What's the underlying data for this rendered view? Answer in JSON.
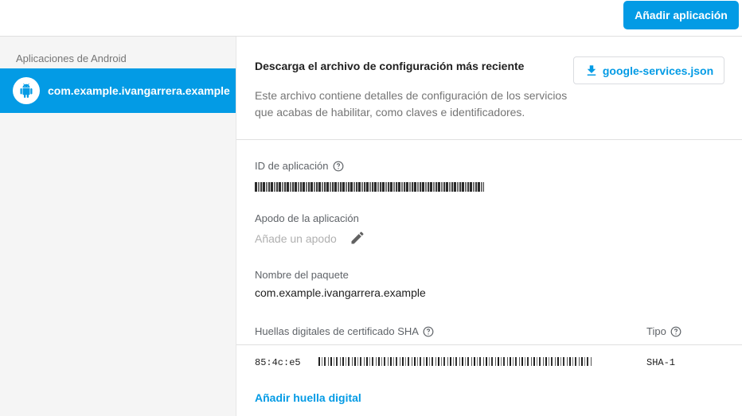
{
  "header": {
    "add_app_label": "Añadir aplicación"
  },
  "sidebar": {
    "heading": "Aplicaciones de Android",
    "items": [
      {
        "label": "com.example.ivangarrera.example",
        "icon": "android-icon"
      }
    ]
  },
  "config": {
    "title": "Descarga el archivo de configuración más reciente",
    "description": "Este archivo contiene detalles de configuración de los servicios que acabas de habilitar, como claves e identificadores.",
    "download_label": "google-services.json"
  },
  "details": {
    "app_id_label": "ID de aplicación",
    "nickname_label": "Apodo de la aplicación",
    "nickname_placeholder": "Añade un apodo",
    "package_label": "Nombre del paquete",
    "package_value": "com.example.ivangarrera.example",
    "sha_label": "Huellas digitales de certificado SHA",
    "type_label": "Tipo",
    "fingerprints": [
      {
        "value_prefix": "85:4c:e5",
        "type": "SHA-1"
      }
    ],
    "add_fingerprint_label": "Añadir huella digital"
  },
  "colors": {
    "accent": "#039be5",
    "sidebar_bg": "#f5f5f5",
    "muted_text": "#757575"
  }
}
